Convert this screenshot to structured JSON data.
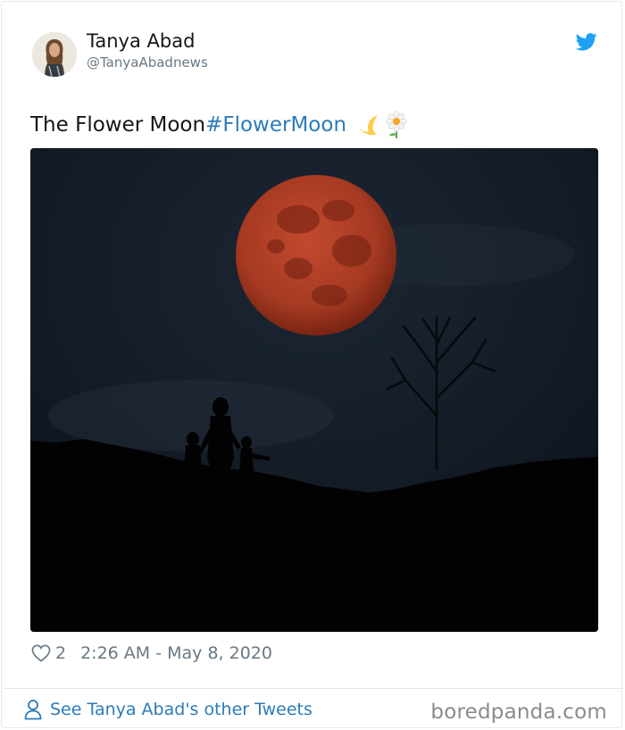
{
  "tweet": {
    "author": {
      "display_name": "Tanya Abad",
      "handle": "@TanyaAbadnews"
    },
    "text": "The Flower Moon",
    "hashtag": "#FlowerMoon",
    "emojis": [
      "crescent-moon-emoji",
      "daisy-flower-emoji"
    ],
    "media": {
      "description_icon": "blood-moon-silhouette-photo"
    },
    "likes": "2",
    "timestamp": "2:26 AM - May 8, 2020"
  },
  "footer": {
    "other_tweets_label": "See Tanya Abad's other Tweets"
  },
  "watermark": "boredpanda.com",
  "colors": {
    "link": "#2b7bb9",
    "twitter_blue": "#1da1f2",
    "muted": "#697882",
    "moon": "#b5402a"
  }
}
